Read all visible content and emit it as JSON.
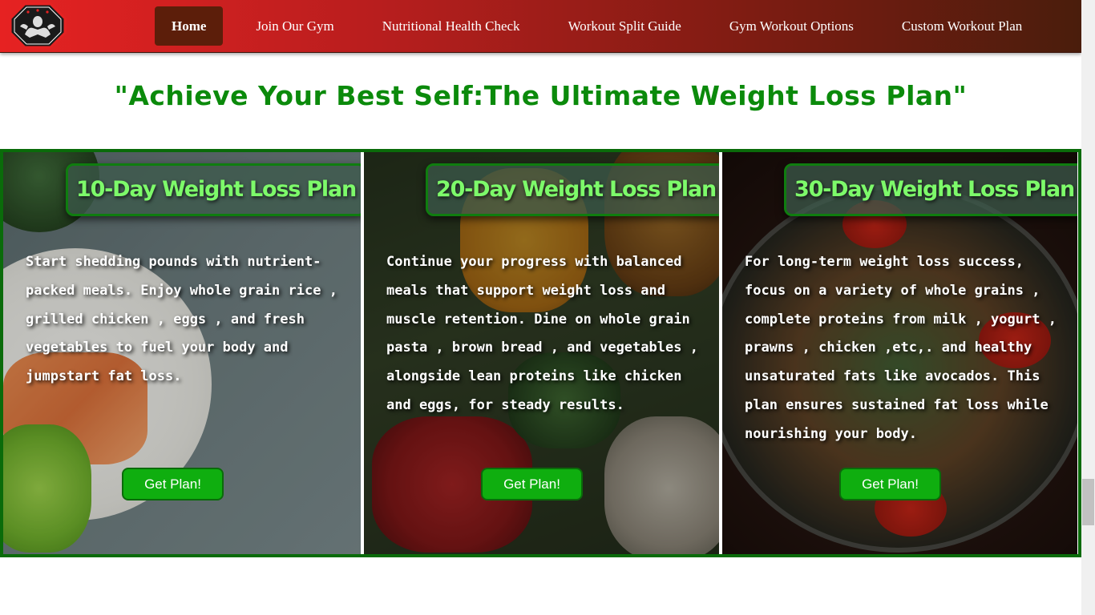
{
  "header": {
    "logo_icon": "gym-bodybuilder-logo-icon",
    "nav": [
      {
        "label": "Home",
        "active": true
      },
      {
        "label": "Join Our Gym"
      },
      {
        "label": "Nutritional Health Check"
      },
      {
        "label": "Workout Split Guide"
      },
      {
        "label": "Gym Workout Options"
      },
      {
        "label": "Custom Workout Plan"
      }
    ]
  },
  "main": {
    "headline": "\"Achieve Your Best Self:The Ultimate Weight Loss Plan\""
  },
  "plans": [
    {
      "title": "10-Day Weight Loss Plan",
      "description": "Start shedding pounds with nutrient-packed meals. Enjoy whole grain rice , grilled chicken , eggs , and fresh vegetables to fuel your body and jumpstart fat loss.",
      "button_label": "Get Plan!"
    },
    {
      "title": "20-Day Weight Loss Plan",
      "description": "Continue your progress with balanced meals that support weight loss and muscle retention. Dine on whole grain pasta , brown bread , and vegetables , alongside lean proteins like chicken and eggs, for steady results.",
      "button_label": "Get Plan!"
    },
    {
      "title": "30-Day Weight Loss Plan",
      "description": "For long-term weight loss success, focus on a variety of whole grains , complete proteins from milk , yogurt , prawns , chicken ,etc,. and healthy unsaturated fats like avocados. This plan ensures sustained fat loss while nourishing your body.",
      "button_label": "Get Plan!"
    }
  ],
  "colors": {
    "headline": "#0b8a0b",
    "card_title_text": "#7dfa6a",
    "button_bg": "#0fae0f",
    "navbar_start": "#e62222",
    "navbar_end": "#4a1d0c"
  }
}
